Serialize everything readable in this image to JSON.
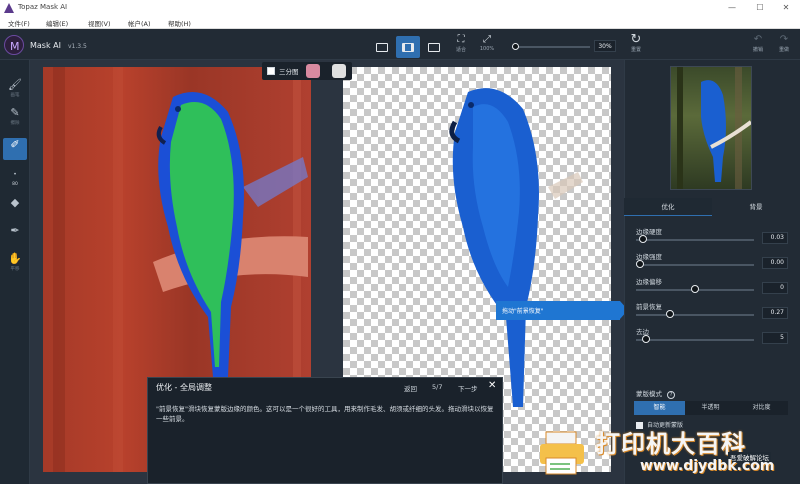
{
  "window": {
    "title": "Topaz Mask AI",
    "minimize": "—",
    "maximize": "☐",
    "close": "✕"
  },
  "menu": [
    "文件(F)",
    "编辑(E)",
    "视图(V)",
    "帐户(A)",
    "帮助(H)"
  ],
  "app": {
    "name": "Mask AI",
    "version": "v1.3.5"
  },
  "toolbar": {
    "fit_label": "适合",
    "zoom_100_label": "100%",
    "zoom_value": "30%",
    "zoom_fraction": 0.0,
    "reset_label": "重置",
    "undo_label": "撤销",
    "redo_label": "重做"
  },
  "left_tools": [
    "画笔",
    "擦除",
    "计算",
    "80",
    "",
    "",
    "平移"
  ],
  "split_view": {
    "label": "三分图"
  },
  "tooltip": {
    "text": "拖动\"前景恢复\""
  },
  "guide": {
    "title": "优化 - 全局调整",
    "back": "返回",
    "page": "5/7",
    "next": "下一步",
    "close": "✕",
    "body": "\"前景恢复\"滑块恢复蒙版边缘的颜色。这可以是一个很好的工具，用来制作毛发、胡须或纤细的头发。拖动滑块以恢复一些前景。"
  },
  "right_panel": {
    "tabs": [
      "优化",
      "背景"
    ],
    "active_tab": 0,
    "params": [
      {
        "label": "边缘硬度",
        "value": "0.03",
        "fraction": 0.03
      },
      {
        "label": "边缘强度",
        "value": "0.00",
        "fraction": 0.0
      },
      {
        "label": "边缘偏移",
        "value": "0",
        "fraction": 0.5
      },
      {
        "label": "前景恢复",
        "value": "0.27",
        "fraction": 0.27
      },
      {
        "label": "去边",
        "value": "5",
        "fraction": 0.05
      }
    ],
    "mask_mode_label": "蒙版模式",
    "mask_mode_help": "?",
    "modes": [
      "智能",
      "半透明",
      "对比度"
    ],
    "active_mode": 0,
    "auto_update_label": "自动更新蒙版"
  },
  "watermark": {
    "title": "打印机大百科",
    "url": "www.djydbk.com",
    "sub": "吾爱破解论坛"
  },
  "colors": {
    "accent": "#2f6fb0",
    "tooltip": "#1f76d2",
    "mask_red": "#b8412c",
    "mask_green": "#2fbf5a",
    "parrot_blue": "#1a5fd0"
  }
}
